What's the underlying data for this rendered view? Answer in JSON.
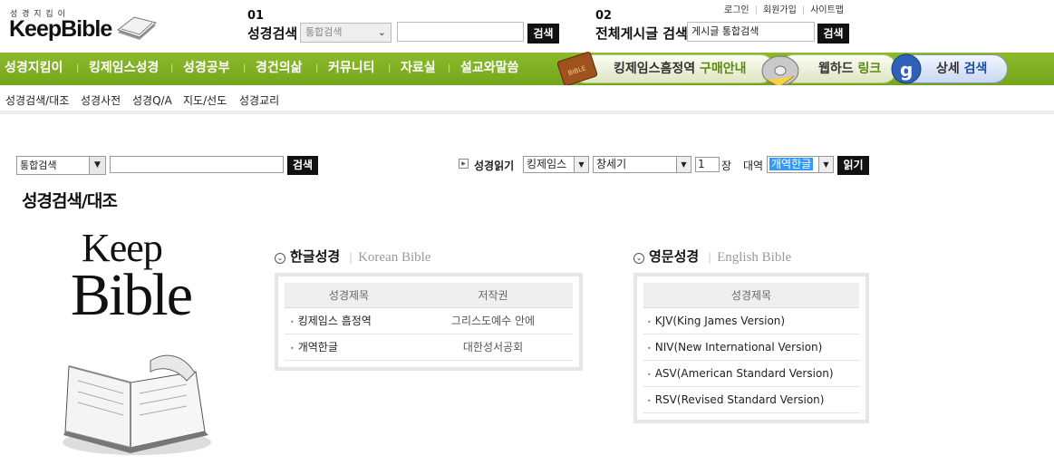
{
  "header": {
    "logo_small": "성 경 지 킴 이",
    "logo_big": "KeepBible",
    "sec1": {
      "num": "01",
      "label": "성경검색",
      "select": "통합검색",
      "button": "검색"
    },
    "sec2": {
      "num": "02",
      "label": "전체게시글 검색",
      "input_value": "게시글 통합검색",
      "button": "검색"
    },
    "toplinks": [
      "로그인",
      "회원가입",
      "사이트맵"
    ]
  },
  "nav": {
    "items": [
      "성경지킴이",
      "킹제임스성경",
      "성경공부",
      "경건의삶",
      "커뮤니티",
      "자료실",
      "설교와말씀"
    ],
    "banners": [
      {
        "label": "킹제임스흠정역",
        "highlight": "구매안내"
      },
      {
        "label": "웹하드",
        "highlight": "링크"
      },
      {
        "label": "상세",
        "highlight": "검색"
      }
    ]
  },
  "subnav": {
    "items": [
      "성경검색/대조",
      "성경사전",
      "성경Q/A",
      "지도/선도",
      "성경교리"
    ]
  },
  "search_bar": {
    "select": "통합검색",
    "button": "검색",
    "read_label": "성경읽기",
    "version": "킹제임스",
    "book": "창세기",
    "chapter": "1",
    "chapter_unit": "장",
    "compare_label": "대역",
    "compare_version": "개역한글",
    "read_button": "읽기"
  },
  "page_title": "성경검색/대조",
  "side_logo": {
    "line1": "Keep",
    "line2": "Bible"
  },
  "korean": {
    "title": "한글성경",
    "subtitle": "Korean Bible",
    "headers": [
      "성경제목",
      "저작권"
    ],
    "rows": [
      {
        "title": "킹제임스 흠정역",
        "copyright": "그리스도예수 안에"
      },
      {
        "title": "개역한글",
        "copyright": "대한성서공회"
      }
    ]
  },
  "english": {
    "title": "영문성경",
    "subtitle": "English Bible",
    "header": "성경제목",
    "rows": [
      "KJV(King James Version)",
      "NIV(New International Version)",
      "ASV(American Standard Version)",
      "RSV(Revised Standard Version)"
    ]
  },
  "colors": {
    "nav_green": "#7fae22",
    "black_button": "#111111",
    "box_border": "#e6e6e6"
  }
}
